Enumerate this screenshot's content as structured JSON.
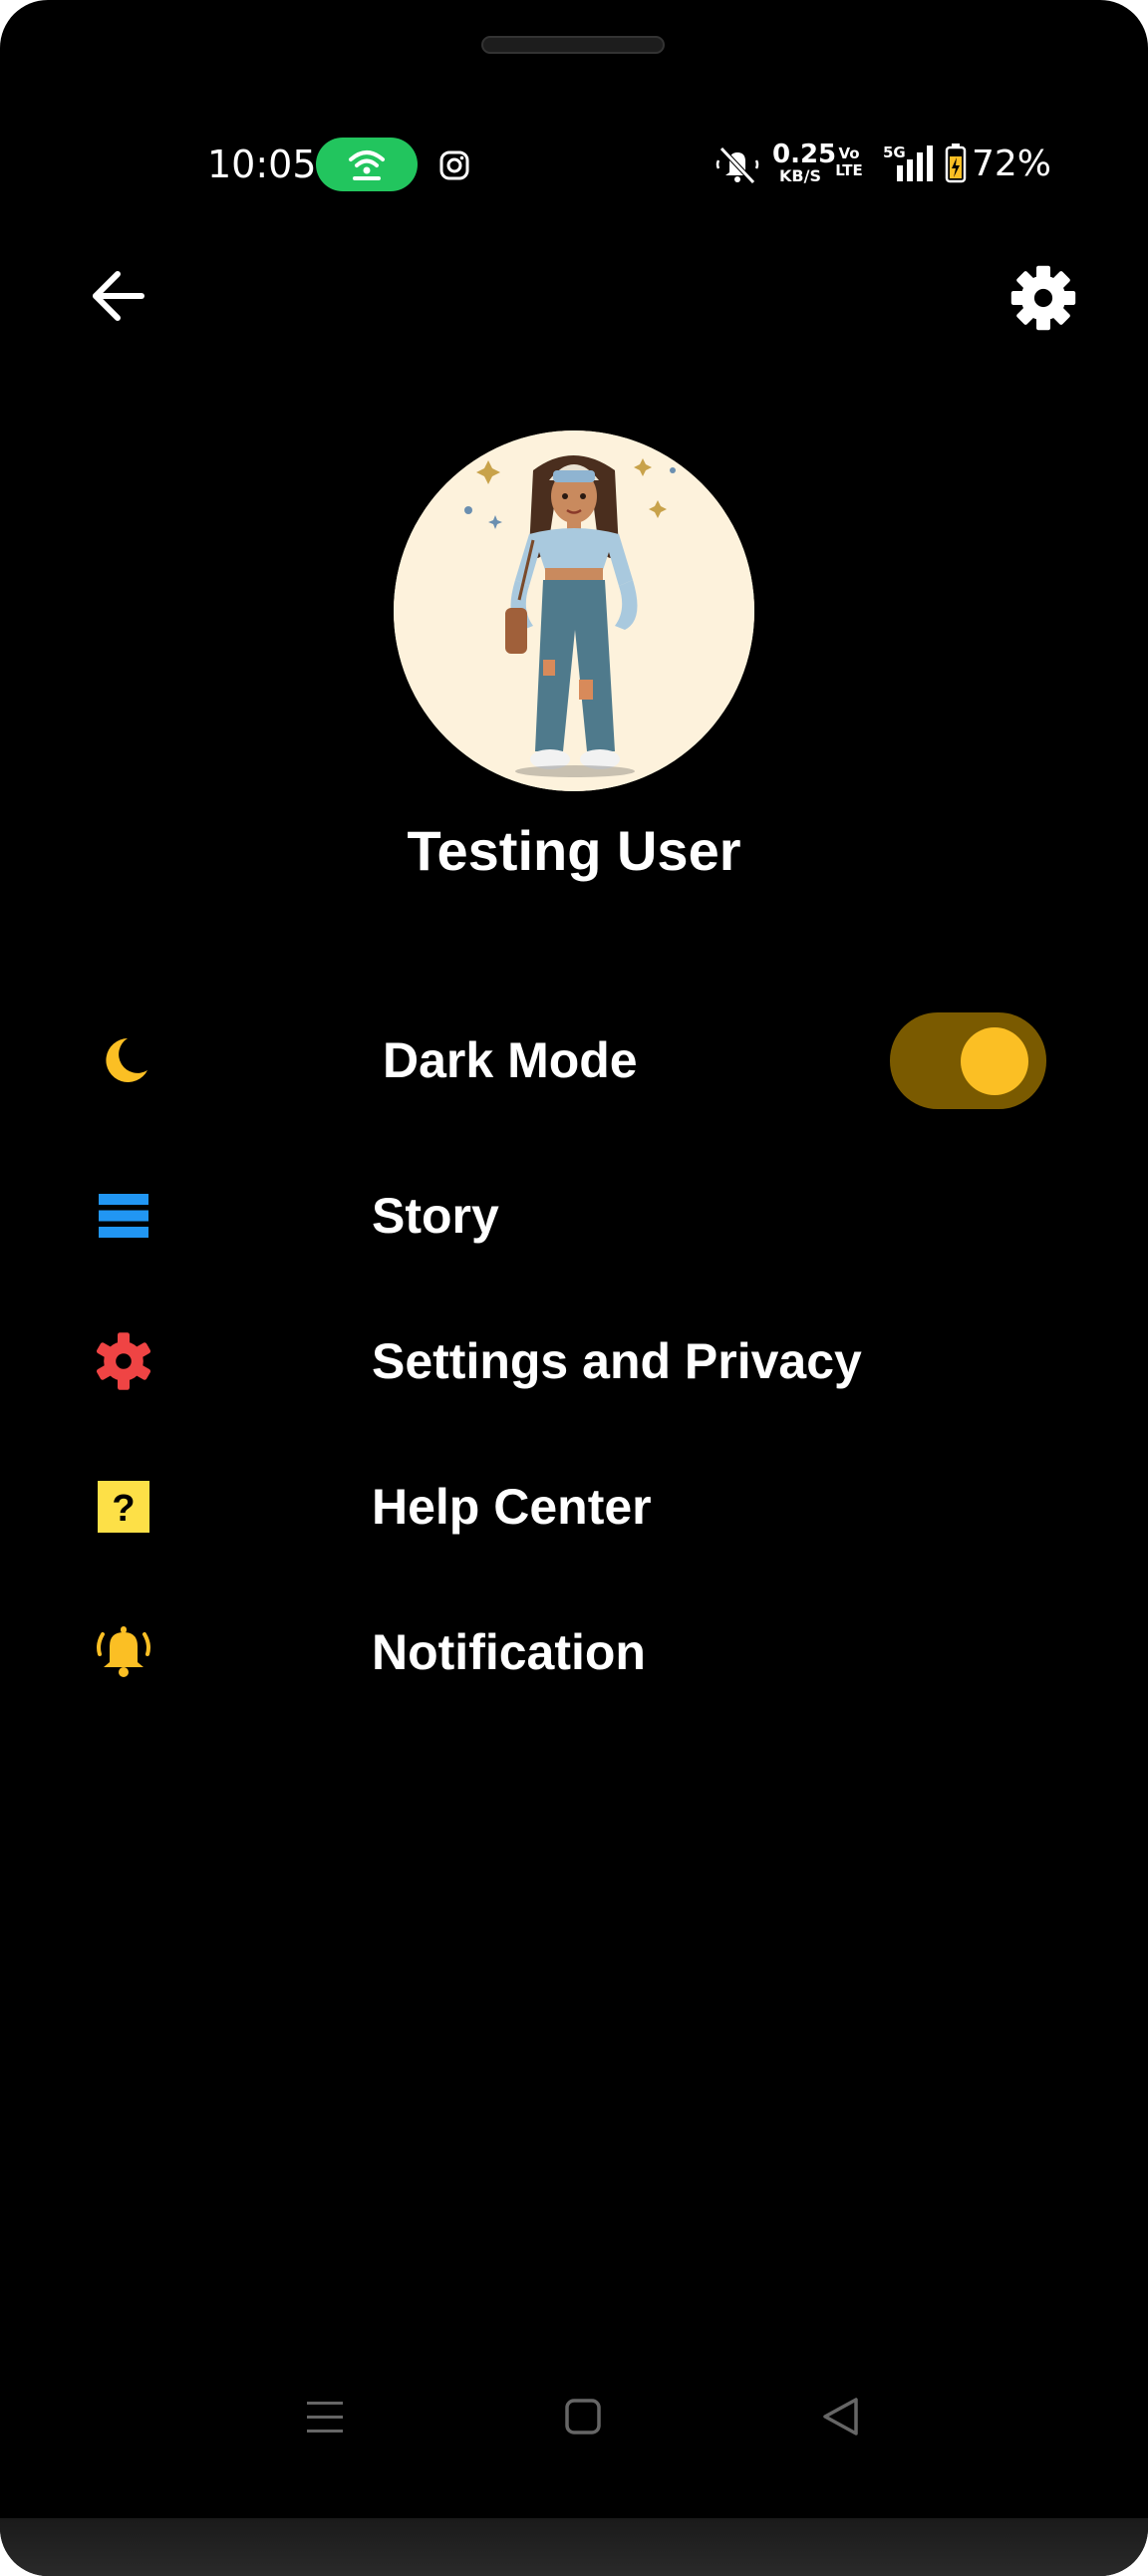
{
  "status_bar": {
    "time": "10:05",
    "net_speed_value": "0.25",
    "net_speed_unit": "KB/S",
    "volte_top": "Vo",
    "volte_bottom": "LTE",
    "network_type": "5G",
    "battery_percent": "72%"
  },
  "profile": {
    "name": "Testing User"
  },
  "menu": {
    "items": [
      {
        "label": "Dark Mode",
        "icon": "moon-icon",
        "color": "#fbbf24"
      },
      {
        "label": "Story",
        "icon": "menu-lines-icon",
        "color": "#2196f3"
      },
      {
        "label": "Settings and Privacy",
        "icon": "gear-icon",
        "color": "#ef4444"
      },
      {
        "label": "Help Center",
        "icon": "help-icon",
        "color": "#fde047"
      },
      {
        "label": "Notification",
        "icon": "bell-icon",
        "color": "#fbbf24"
      }
    ],
    "dark_mode_on": true
  },
  "colors": {
    "background": "#000000",
    "accent": "#fbbf24",
    "hotspot": "#22c55e"
  }
}
